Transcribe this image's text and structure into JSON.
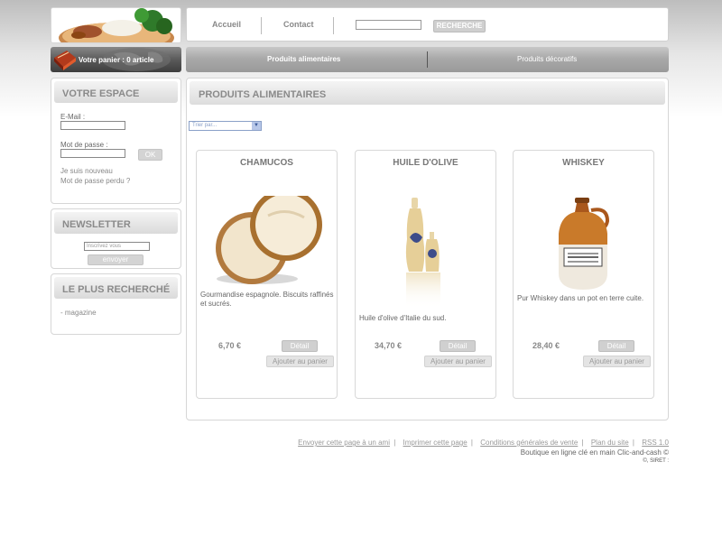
{
  "topnav": {
    "home": "Accueil",
    "contact": "Contact",
    "search_button": "RECHERCHE"
  },
  "cart": {
    "text": "Votre panier : 0 article"
  },
  "categories": {
    "food": "Produits alimentaires",
    "decor": "Produits décoratifs"
  },
  "account": {
    "title": "VOTRE ESPACE",
    "email_label": "E-Mail :",
    "password_label": "Mot de passe :",
    "ok_button": "OK",
    "new_user": "Je suis nouveau",
    "lost_password": "Mot de passe perdu ?"
  },
  "newsletter": {
    "title": "NEWSLETTER",
    "placeholder": "Inscrivez vous",
    "send_button": "envoyer"
  },
  "most_searched": {
    "title": "LE PLUS RECHERCHÉ",
    "items": [
      "- magazine"
    ]
  },
  "main": {
    "title": "PRODUITS ALIMENTAIRES",
    "sort_placeholder": "Trier par...",
    "sort_arrow": "▼"
  },
  "products": [
    {
      "name": "CHAMUCOS",
      "description": "Gourmandise espagnole. Biscuits raffinés et sucrés.",
      "price": "6,70 €",
      "detail": "Détail",
      "add_to_cart": "Ajouter au panier"
    },
    {
      "name": "HUILE D'OLIVE",
      "description": "Huile d'olive d'Italie du sud.",
      "price": "34,70 €",
      "detail": "Détail",
      "add_to_cart": "Ajouter au panier"
    },
    {
      "name": "WHISKEY",
      "description": "Pur Whiskey dans un pot en terre cuite.",
      "price": "28,40 €",
      "detail": "Détail",
      "add_to_cart": "Ajouter au panier"
    }
  ],
  "footer": {
    "links": [
      "Envoyer cette page à un ami",
      "Imprimer cette page",
      "Conditions générales de vente",
      "Plan du site",
      "RSS 1.0"
    ],
    "separator": "|",
    "tagline": "Boutique en ligne clé en main Clic-and-cash ©",
    "siret": "©, SIRET :"
  },
  "colors": {
    "accent_gray": "#8a8a8a",
    "button_gray": "#d0d0d0"
  }
}
